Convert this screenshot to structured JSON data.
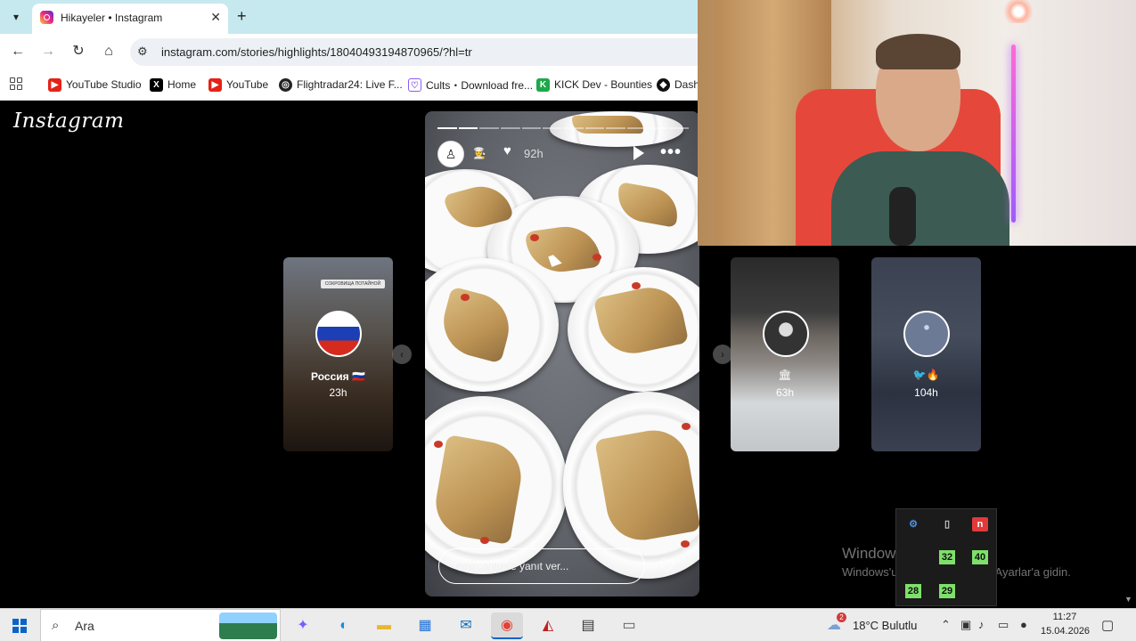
{
  "browser": {
    "tab_title": "Hikayeler • Instagram",
    "url": "instagram.com/stories/highlights/18040493194870965/?hl=tr",
    "bookmarks": [
      {
        "label": "YouTube Studio",
        "color": "#e62117"
      },
      {
        "label": "Home",
        "color": "#000000"
      },
      {
        "label": "YouTube",
        "color": "#e62117"
      },
      {
        "label": "Flightradar24: Live F...",
        "color": "#222222"
      },
      {
        "label": "Cults・Download fre...",
        "color": "#8a5cf5"
      },
      {
        "label": "KICK Dev - Bounties",
        "color": "#1ea84a"
      },
      {
        "label": "Dash",
        "color": "#111111"
      }
    ]
  },
  "instagram": {
    "logo": "Instagram",
    "left_card": {
      "tagline": "СОКРОВИЩА ПОТАЙНОЙ МОСКВЫ",
      "name": "Россия 🇷🇺",
      "age": "23h"
    },
    "mid_card": {
      "emoji": "🏛",
      "age": "63h"
    },
    "right_card": {
      "emoji": "🐦🔥",
      "age": "104h"
    },
    "story": {
      "segments_total": 12,
      "segments_done": 2,
      "avatar_glyph": "♙",
      "emoji": "👨‍🍳",
      "age": "92h",
      "reply_placeholder": "emircantgs'e yanıt ver..."
    }
  },
  "watermark": {
    "line1": "Windows'u Etkinleştir",
    "line2": "Windows'u etkinleştirmek için Ayarlar'a gidin."
  },
  "tray_popup": [
    {
      "label": "⚙",
      "color": "#4a90e2"
    },
    {
      "label": "▯",
      "color": "#cccccc"
    },
    {
      "label": "n",
      "color": "#e03a3a"
    },
    {
      "label": "32",
      "color": "#7ee06a"
    },
    {
      "label": "40",
      "color": "#7ee06a"
    },
    {
      "label": "28",
      "color": "#7ee06a"
    },
    {
      "label": "29",
      "color": "#7ee06a"
    }
  ],
  "taskbar": {
    "search_label": "Ara",
    "weather": "18°C  Bulutlu",
    "weather_badge": "2",
    "time": "11:27",
    "date": "15.04.2026"
  }
}
